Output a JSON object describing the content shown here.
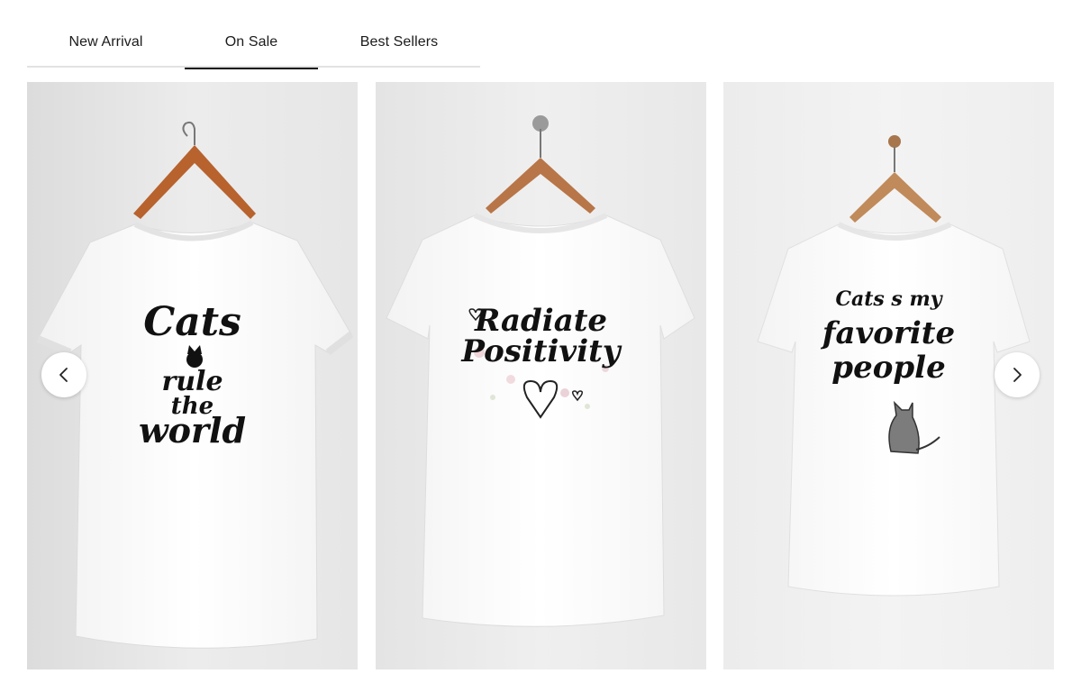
{
  "tabs": [
    {
      "label": "New Arrival",
      "active": false
    },
    {
      "label": "On Sale",
      "active": true
    },
    {
      "label": "Best Sellers",
      "active": false
    }
  ],
  "products": [
    {
      "print_lines": [
        "Cats",
        "rule",
        "the",
        "world"
      ]
    },
    {
      "print_lines": [
        "Radiate",
        "Positivity"
      ]
    },
    {
      "print_lines": [
        "Cats s my",
        "favorite",
        "people"
      ]
    }
  ],
  "carousel": {
    "prev_icon": "chevron-left-icon",
    "next_icon": "chevron-right-icon"
  },
  "colors": {
    "active_tab_underline": "#111111",
    "tab_divider": "#e2e2e2",
    "card_background": "#e9e9e9"
  }
}
